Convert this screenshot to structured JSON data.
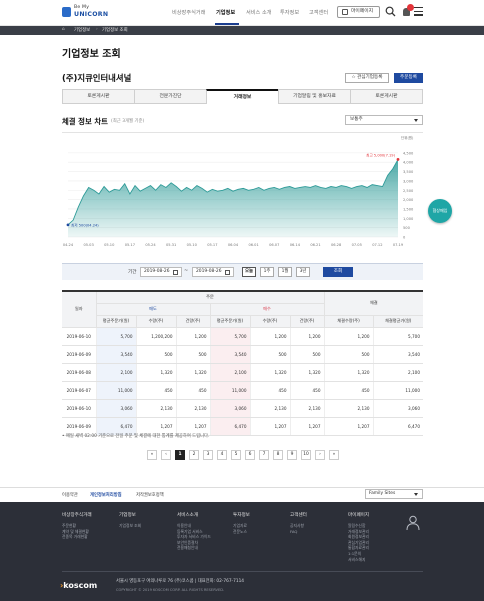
{
  "header": {
    "logo_top": "Be My",
    "logo_bottom": "UNICORN",
    "nav": [
      "비상장주식거래",
      "기업정보",
      "서비스 소개",
      "투자정보",
      "고객센터"
    ],
    "active_nav": "기업정보",
    "mypage": "마이페이지"
  },
  "breadcrumb": {
    "current": "기업정보",
    "page": "기업정보 조회"
  },
  "page_title": "기업정보 조회",
  "company": {
    "name": "(주)지큐인터내셔널",
    "interest_button": "관심기업등록",
    "stock_register_button": "주문등록"
  },
  "tabs": [
    "토론게시판",
    "전문가진단",
    "거래정보",
    "기업알림 및 홍보자료",
    "토론게시판"
  ],
  "active_tab": 2,
  "chart_section": {
    "title": "체결 정보 차트",
    "subtitle": "(최근 3개월 기준)",
    "select": "보통주"
  },
  "chart_data": {
    "type": "area",
    "unit_label": "단위(원)",
    "x_ticks": [
      "04.24",
      "05.03",
      "05.10",
      "05.17",
      "05.24",
      "05.31",
      "05.10",
      "05.17",
      "06.04",
      "06.01",
      "06.07",
      "06.14",
      "06.21",
      "06.28",
      "07.05",
      "07.12",
      "07.19"
    ],
    "y_ticks": [
      "0",
      "500",
      "1,000",
      "1,500",
      "2,000",
      "2,500",
      "3,000",
      "3,500",
      "4,000",
      "4,500"
    ],
    "ylim": [
      0,
      4600
    ],
    "values": [
      650,
      900,
      1600,
      2200,
      2650,
      2500,
      2300,
      2700,
      2400,
      2550,
      2500,
      2850,
      2300,
      2750,
      2450,
      2600,
      2750,
      2500,
      2800,
      2650,
      2900,
      2700,
      2450,
      2650,
      2500,
      2750,
      2600,
      2400,
      2550,
      2450,
      2500,
      2600,
      2450,
      2550,
      2600,
      2500,
      2550,
      2650,
      2500,
      2600,
      2650,
      2550,
      2650,
      2700,
      2600,
      2650,
      2700,
      2650,
      2750,
      2650,
      2600,
      2700,
      2650,
      2750,
      2700,
      2600,
      2700,
      2750,
      2650,
      2800,
      2750,
      2700,
      3300,
      3650,
      4150
    ],
    "max_label": "최고 5,000(7.19)",
    "min_label": "최저 500(04.24)",
    "color": "#2e9b98"
  },
  "invest_badge": "협상매입",
  "filter": {
    "label": "기간",
    "from": "2019-08-26",
    "to": "2019-08-26",
    "tilde": "~",
    "periods": [
      "오늘",
      "1주",
      "1월",
      "3년"
    ],
    "active_period": "오늘",
    "lookup": "조회"
  },
  "table": {
    "h_date": "일자",
    "h_order": "주문",
    "h_trade": "체결",
    "h_buy": "매도",
    "h_sell": "매수",
    "sub": [
      "평균주문가(원)",
      "수량(주)",
      "건량(주)",
      "평균주문가(원)",
      "수량(주)",
      "건량(주)",
      "체결수량(주)",
      "체결평균가(원)"
    ],
    "rows": [
      [
        "2019-06-10",
        "5,700",
        "1,200,200",
        "1,200",
        "5,700",
        "1,200",
        "1,200",
        "1,200",
        "5,700"
      ],
      [
        "2019-06-09",
        "3,540",
        "500",
        "500",
        "3,540",
        "500",
        "500",
        "500",
        "3,540"
      ],
      [
        "2019-06-08",
        "2,100",
        "1,320",
        "1,320",
        "2,100",
        "1,320",
        "1,320",
        "1,320",
        "2,100"
      ],
      [
        "2019-06-07",
        "11,000",
        "450",
        "450",
        "11,000",
        "450",
        "450",
        "450",
        "11,000"
      ],
      [
        "2019-06-10",
        "3,060",
        "2,130",
        "2,130",
        "3,060",
        "2,130",
        "2,130",
        "2,130",
        "3,060"
      ],
      [
        "2019-06-09",
        "6,470",
        "1,207",
        "1,207",
        "6,470",
        "1,207",
        "1,207",
        "1,207",
        "6,470"
      ]
    ]
  },
  "note": "• 매일 새벽 02:00 기준으로 전일 주문 및 체결에 대한 통계를 제공하여 드립니다.",
  "pager": {
    "first": "«",
    "prev": "‹",
    "pages": [
      "1",
      "2",
      "3",
      "4",
      "5",
      "6",
      "7",
      "8",
      "9",
      "10"
    ],
    "active": "1",
    "next": "›",
    "last": "»"
  },
  "footer_nav": {
    "links": [
      "이용약관",
      "개인정보처리방침",
      "저작권보호정책"
    ],
    "active": "개인정보처리방침",
    "family": "Family Sites"
  },
  "footer": {
    "cols": [
      {
        "h": "비상장주식거래",
        "items": [
          "주문현황",
          "계약 및 체결현황",
          "전종목 거래현황"
        ]
      },
      {
        "h": "기업정보",
        "items": [
          "기업정보 조회"
        ]
      },
      {
        "h": "서비스소개",
        "items": [
          "이용안내",
          "등록기업 서비스",
          "투자자 서비스 가이드",
          "보안인증절차",
          "전용매칭안내"
        ]
      },
      {
        "h": "투자정보",
        "items": [
          "기업자료",
          "전문노스"
        ]
      },
      {
        "h": "고객센터",
        "items": [
          "공지사항",
          "FAQ"
        ]
      },
      {
        "h": "마이페이지",
        "items": [
          "알림수신함",
          "거래정보관리",
          "회원정보관리",
          "관심기업관리",
          "통합자료관리",
          "1:1문의",
          "서비스해지"
        ]
      }
    ],
    "brand": "koscom",
    "brand_prefix": "›",
    "address": "서울시 영등포구 여의나루로 76 (주)코스콤  |  대표전화: 02-767-7114",
    "copyright": "COPYRIGHT © 2019 KOSCOM CORP. ALL RIGHTS RESERVED."
  }
}
